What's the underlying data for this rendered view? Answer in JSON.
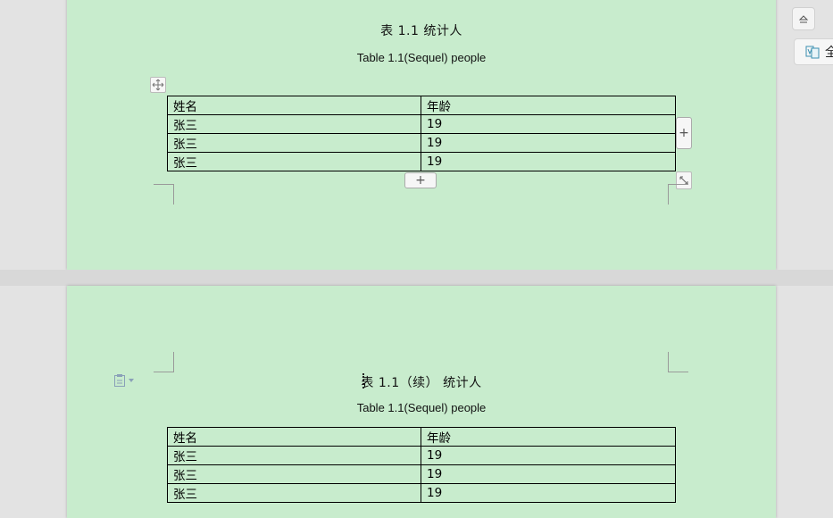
{
  "page1": {
    "caption_cn": "表 1.1  统计人",
    "caption_en": "Table 1.1(Sequel) people",
    "table": {
      "rows": [
        [
          "姓名",
          "年龄"
        ],
        [
          "张三",
          "19"
        ],
        [
          "张三",
          "19"
        ],
        [
          "张三",
          "19"
        ]
      ]
    },
    "add_col_symbol": "+",
    "add_row_symbol": "+"
  },
  "page2": {
    "caption_cn": "表 1.1（续） 统计人",
    "caption_en": "Table 1.1(Sequel) people",
    "table": {
      "rows": [
        [
          "姓名",
          "年龄"
        ],
        [
          "张三",
          "19"
        ],
        [
          "张三",
          "19"
        ],
        [
          "张三",
          "19"
        ]
      ]
    }
  },
  "sidebar": {
    "translate_label": "全"
  },
  "colors": {
    "page_background": "#c8eccd",
    "workspace": "#e3e3e3"
  }
}
